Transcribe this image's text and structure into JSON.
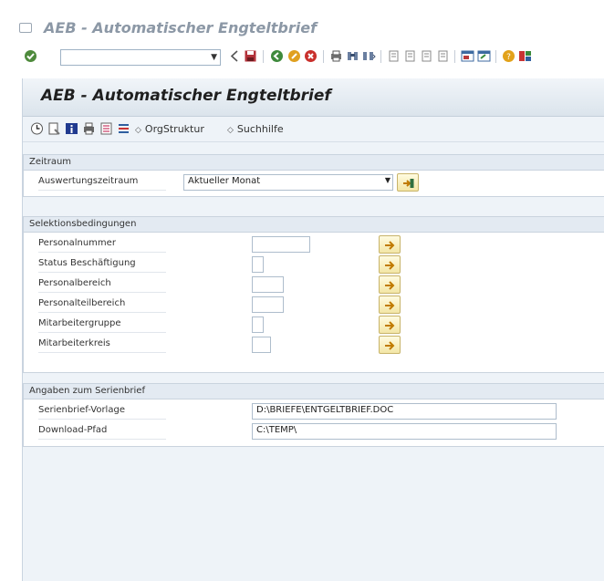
{
  "window": {
    "title": "AEB - Automatischer Engteltbrief"
  },
  "app": {
    "title": "AEB - Automatischer Engteltbrief"
  },
  "app_toolbar": {
    "orgstruktur_label": "OrgStruktur",
    "suchhilfe_label": "Suchhilfe"
  },
  "zeitraum": {
    "header": "Zeitraum",
    "label": "Auswertungszeitraum",
    "value": "Aktueller Monat"
  },
  "selektion": {
    "header": "Selektionsbedingungen",
    "rows": [
      {
        "label": "Personalnummer",
        "value": ""
      },
      {
        "label": "Status Beschäftigung",
        "value": ""
      },
      {
        "label": "Personalbereich",
        "value": ""
      },
      {
        "label": "Personalteilbereich",
        "value": ""
      },
      {
        "label": "Mitarbeitergruppe",
        "value": ""
      },
      {
        "label": "Mitarbeiterkreis",
        "value": ""
      }
    ]
  },
  "serienbrief": {
    "header": "Angaben zum Serienbrief",
    "vorlage_label": "Serienbrief-Vorlage",
    "vorlage_value": "D:\\BRIEFE\\ENTGELTBRIEF.DOC",
    "pfad_label": "Download-Pfad",
    "pfad_value": "C:\\TEMP\\"
  },
  "colors": {
    "accent": "#1f1f1f",
    "panel": "#eef3f8",
    "group_header": "#e3eaf2",
    "button_yellow": "#f3e6a6"
  }
}
